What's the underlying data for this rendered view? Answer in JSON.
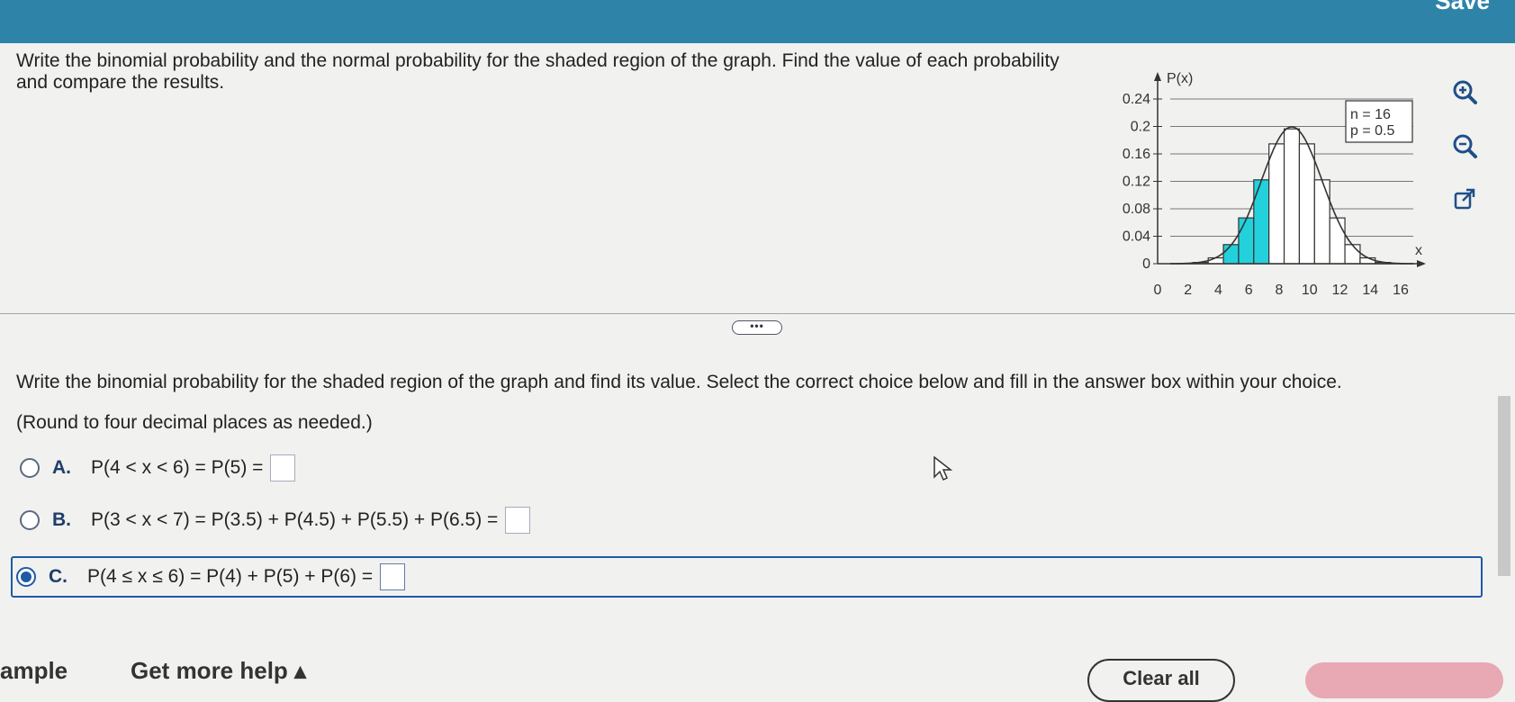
{
  "header": {
    "save_label": "Save"
  },
  "question": {
    "prompt": "Write the binomial probability and the normal probability for the shaded region of the graph. Find the value of each probability and compare the results."
  },
  "graph": {
    "y_axis_label": "P(x)",
    "x_axis_label": "x",
    "params_n": "n = 16",
    "params_p": "p = 0.5",
    "y_ticks": [
      "0.24",
      "0.2",
      "0.16",
      "0.12",
      "0.08",
      "0.04",
      "0"
    ],
    "x_ticks": [
      "0",
      "2",
      "4",
      "6",
      "8",
      "10",
      "12",
      "14",
      "16"
    ]
  },
  "chart_data": {
    "type": "bar",
    "x": [
      0,
      1,
      2,
      3,
      4,
      5,
      6,
      7,
      8,
      9,
      10,
      11,
      12,
      13,
      14,
      15,
      16
    ],
    "values": [
      0.0,
      0.0002,
      0.0018,
      0.0085,
      0.0278,
      0.0667,
      0.1222,
      0.1746,
      0.1964,
      0.1746,
      0.1222,
      0.0667,
      0.0278,
      0.0085,
      0.0018,
      0.0002,
      0.0
    ],
    "shaded_x": [
      4,
      5,
      6
    ],
    "ylim": [
      0,
      0.24
    ],
    "xlim": [
      0,
      16
    ],
    "xlabel": "x",
    "ylabel": "P(x)",
    "overlay": "normal curve"
  },
  "tools": {
    "zoom_in": "zoom-in-icon",
    "zoom_out": "zoom-out-icon",
    "popout": "external-link-icon"
  },
  "colors": {
    "shade": "#23d1dc",
    "accent": "#1f5aa6",
    "topbar": "#2e84a8"
  },
  "divider_handle": "•••",
  "part": {
    "instruction": "Write the binomial probability for the shaded region of the graph and find its value. Select the correct choice below and fill in the answer box within your choice.",
    "round_note": "(Round to four decimal places as needed.)",
    "choices": [
      {
        "letter": "A.",
        "expr": "P(4 < x < 6) = P(5) =",
        "selected": false
      },
      {
        "letter": "B.",
        "expr": "P(3 < x < 7) = P(3.5) + P(4.5) + P(5.5) + P(6.5) =",
        "selected": false
      },
      {
        "letter": "C.",
        "expr": "P(4 ≤ x ≤ 6) = P(4) + P(5) + P(6) =",
        "selected": true
      }
    ]
  },
  "footer": {
    "example": "ample",
    "help": "Get more help ▴",
    "clear_all": "Clear all"
  }
}
